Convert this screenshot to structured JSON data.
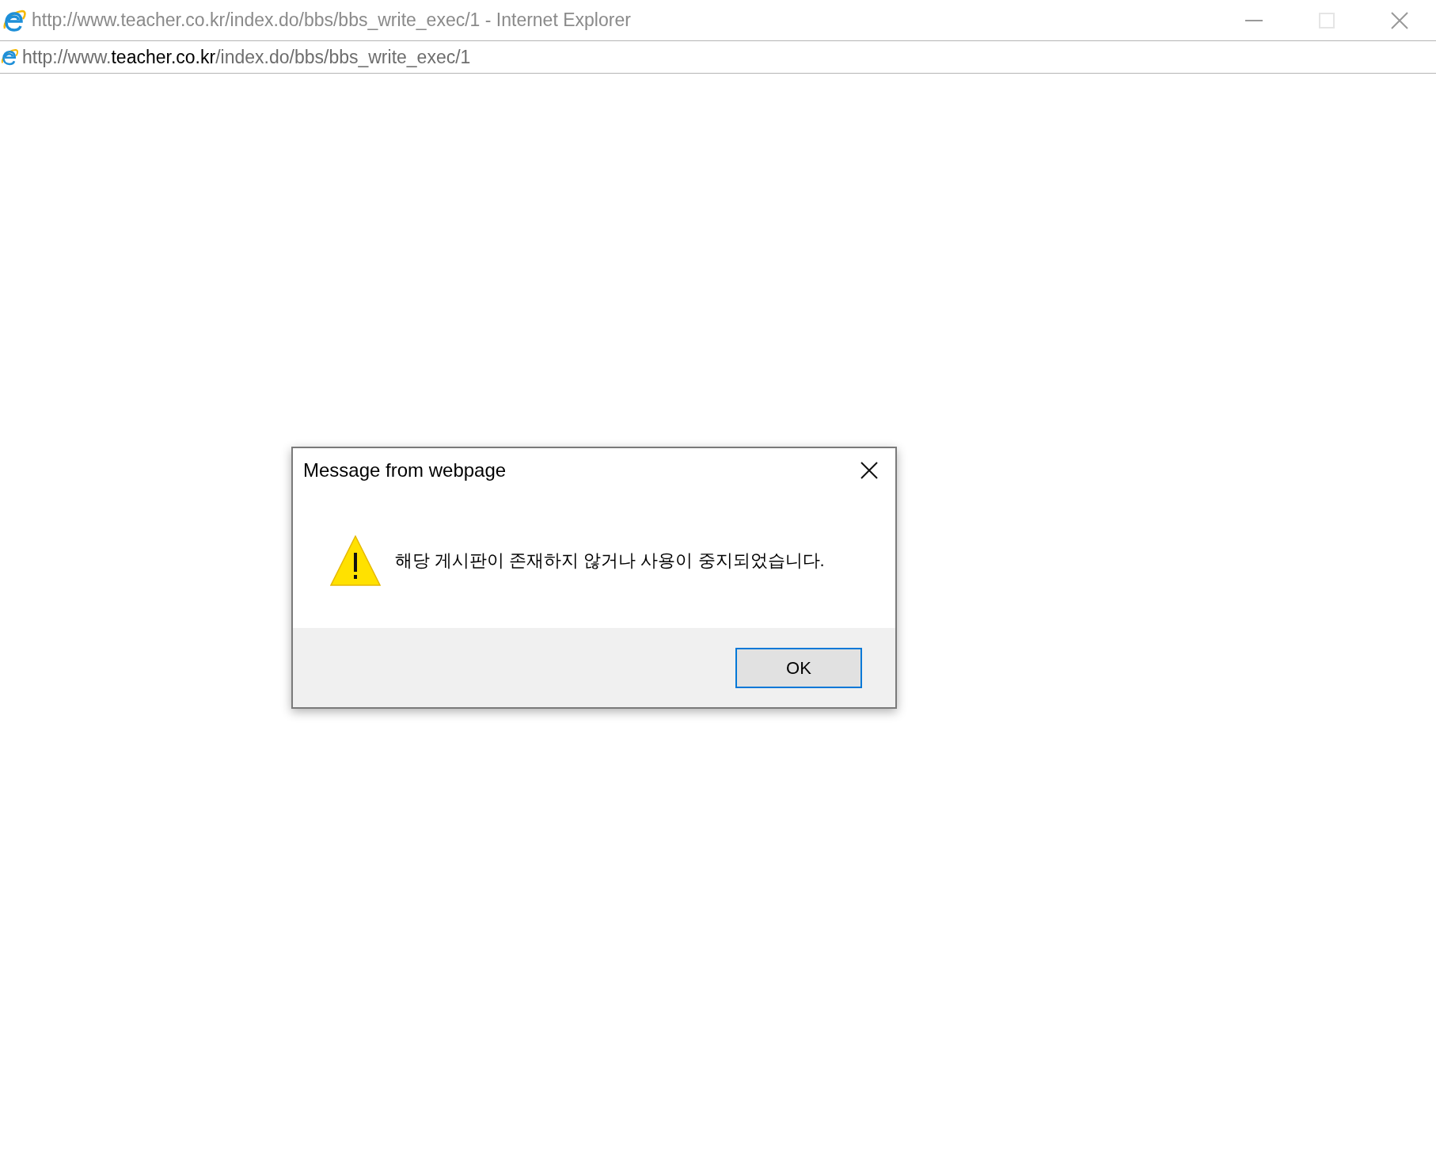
{
  "window": {
    "title": "http://www.teacher.co.kr/index.do/bbs/bbs_write_exec/1 - Internet Explorer"
  },
  "address_bar": {
    "prefix": "http://www.",
    "host": "teacher.co.kr",
    "path": "/index.do/bbs/bbs_write_exec/1"
  },
  "dialog": {
    "title": "Message from webpage",
    "message": "해당 게시판이 존재하지 않거나 사용이 중지되었습니다.",
    "buttons": [
      {
        "label": "OK",
        "selected": true
      }
    ]
  }
}
